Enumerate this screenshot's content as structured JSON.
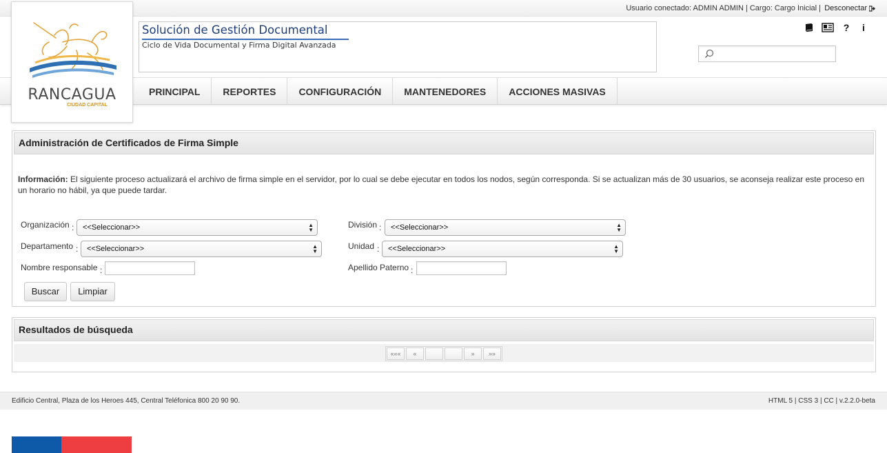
{
  "topbar": {
    "user_text": "Usuario conectado: ADMIN ADMIN | Cargo: Cargo Inicial |",
    "logout_label": "Desconectar"
  },
  "logo": {
    "name": "RANCAGUA",
    "tagline": "CIUDAD CAPITAL"
  },
  "header": {
    "title": "Solución de Gestión Documental",
    "subtitle": "Ciclo de Vida Documental y Firma Digital Avanzada",
    "icons": [
      "book-icon",
      "newspaper-icon",
      "help-icon",
      "info-icon"
    ],
    "search_placeholder": ""
  },
  "nav": {
    "items": [
      "PRINCIPAL",
      "REPORTES",
      "CONFIGURACIÓN",
      "MANTENEDORES",
      "ACCIONES MASIVAS"
    ]
  },
  "admin_panel": {
    "title": "Administración de Certificados de Firma Simple",
    "info_label": "Información:",
    "info_text": " El siguiente proceso actualizará el archivo de firma simple en el servidor, por lo cual se debe ejecutar en todos los nodos, según corresponda. Si se actualizan más de 30 usuarios, se aconseja realizar este proceso en un horario no hábil, ya que puede tardar.",
    "fields": {
      "organizacion": {
        "label": "Organización",
        "value": "<<Seleccionar>>"
      },
      "division": {
        "label": "División",
        "value": "<<Seleccionar>>"
      },
      "departamento": {
        "label": "Departamento",
        "value": "<<Seleccionar>>"
      },
      "unidad": {
        "label": "Unidad",
        "value": "<<Seleccionar>>"
      },
      "nombre_responsable": {
        "label": "Nombre responsable",
        "value": ""
      },
      "apellido_paterno": {
        "label": "Apellido Paterno",
        "value": ""
      }
    },
    "colon": ":",
    "search_button": "Buscar",
    "clear_button": "Limpiar"
  },
  "results_panel": {
    "title": "Resultados de búsqueda",
    "pager": {
      "first": "«««",
      "prev": "«",
      "page1": "",
      "page2": "",
      "next": "»",
      "last": "»»"
    }
  },
  "footer": {
    "address": "Edificio Central, Plaza de los Heroes 445, Central Teléfonica 800 20 90 90.",
    "version": "HTML 5 | CSS 3 | CC | v.2.2.0-beta"
  },
  "colors": {
    "title_blue": "#1d3e7e",
    "flag_blue": "#0f5aa8",
    "flag_red": "#ef3e42",
    "logo_gold": "#d5941e"
  }
}
